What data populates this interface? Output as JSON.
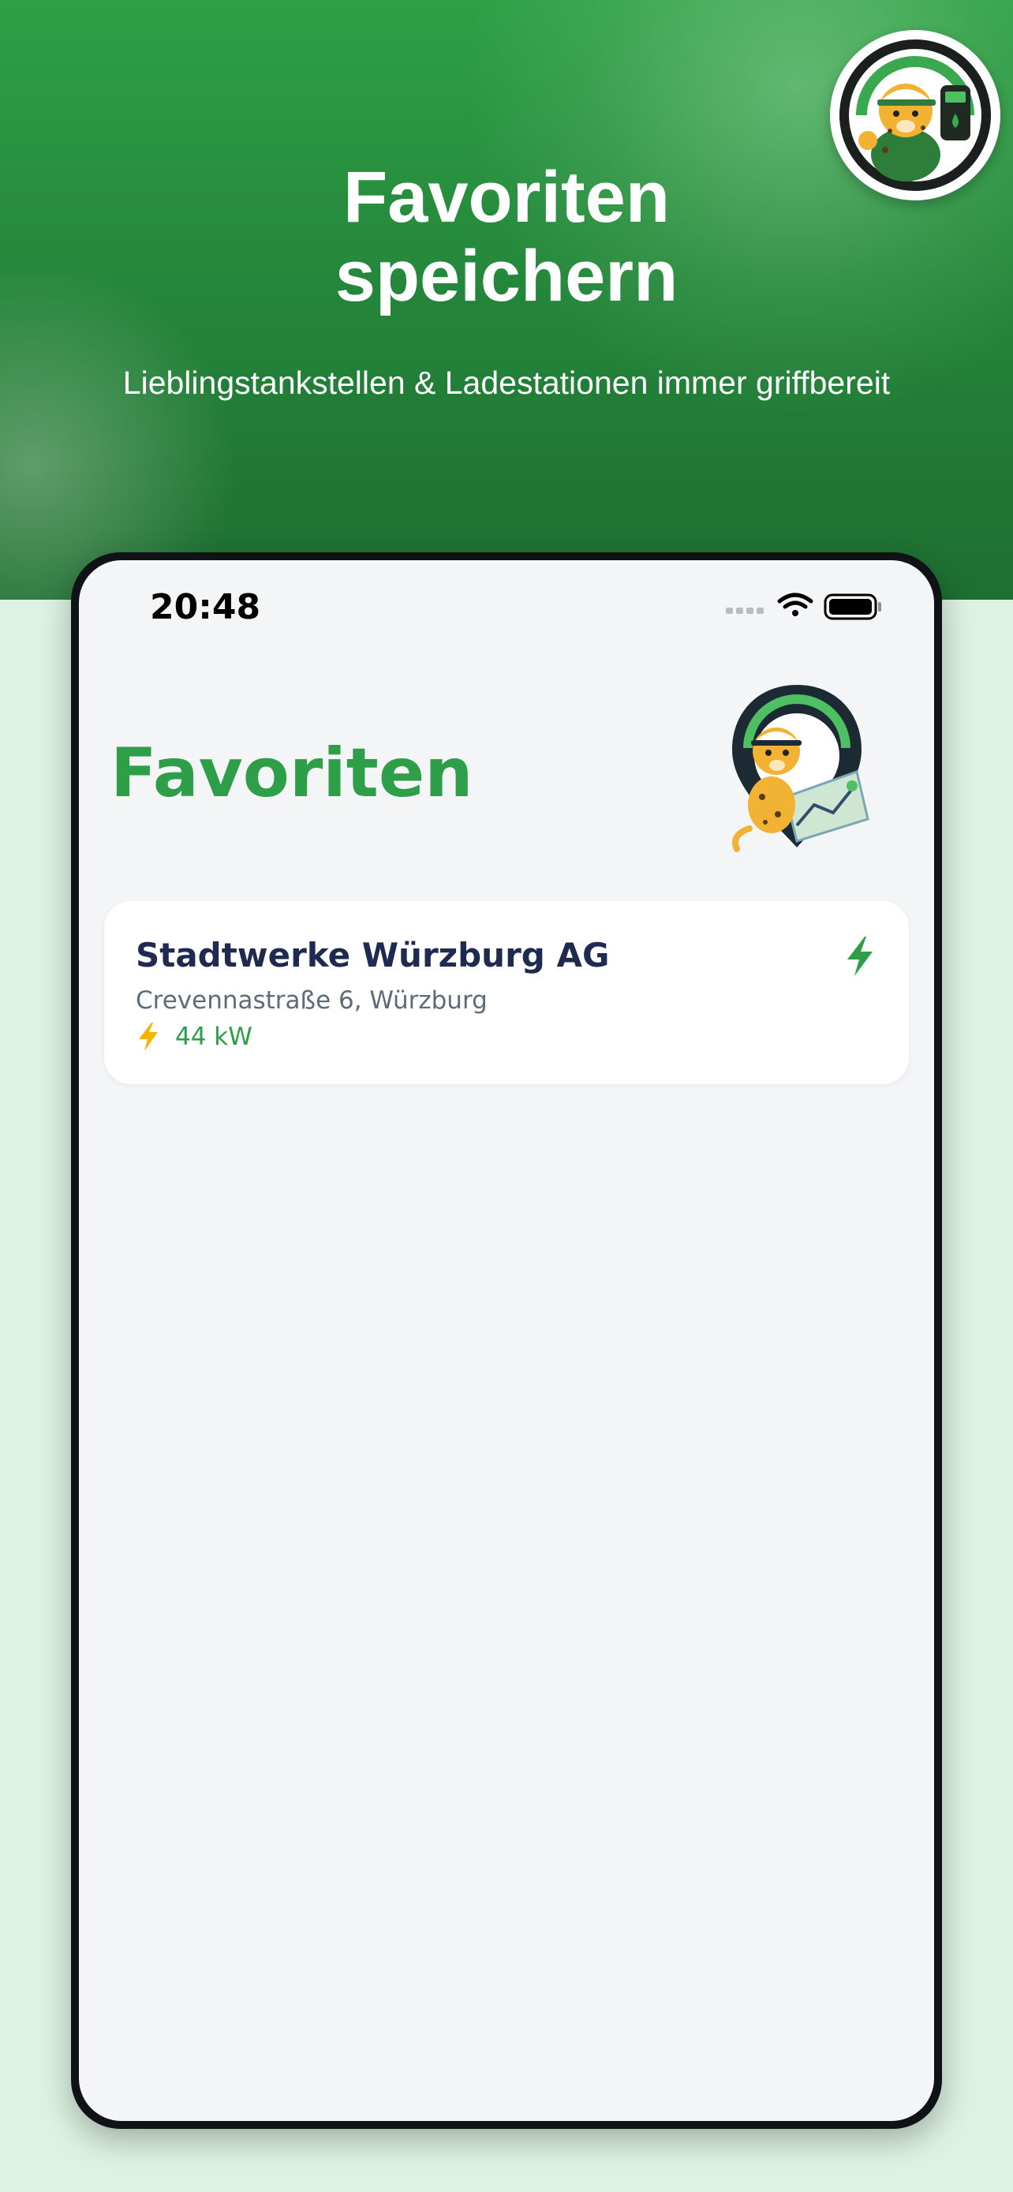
{
  "hero": {
    "title_line1": "Favoriten",
    "title_line2": "speichern",
    "subtitle": "Lieblingstankstellen & Ladestationen immer griffbereit"
  },
  "status_bar": {
    "time": "20:48",
    "icons": [
      "signal-icon",
      "wifi-icon",
      "battery-icon"
    ]
  },
  "screen": {
    "title": "Favoriten",
    "favorites": [
      {
        "name": "Stadtwerke Würzburg AG",
        "address": "Crevennastraße 6, Würzburg",
        "power": "44 kW",
        "type_icon": "ev-charging-bolt-icon"
      }
    ]
  },
  "colors": {
    "brand_green": "#2e9e48",
    "hero_green": "#24853a",
    "background_mint": "#dcf2e2",
    "card_title": "#1e2a4f",
    "muted_text": "#5f6b7a",
    "bolt_amber": "#f5b400"
  }
}
